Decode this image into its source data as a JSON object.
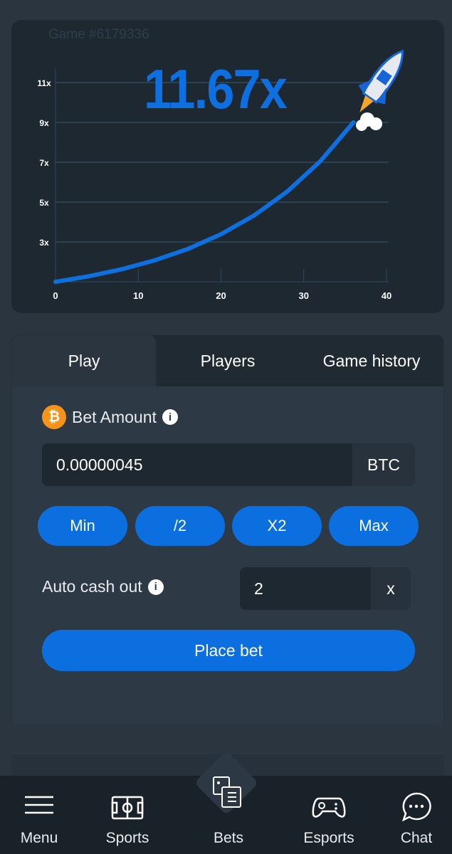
{
  "game": {
    "id_label": "Game #6179336",
    "multiplier": "11.67x"
  },
  "chart_data": {
    "type": "line",
    "x_ticks": [
      "0",
      "10",
      "20",
      "30",
      "40"
    ],
    "y_ticks": [
      "3x",
      "5x",
      "7x",
      "9x",
      "11x"
    ],
    "xlim": [
      0,
      40
    ],
    "ylim": [
      1,
      12
    ],
    "grid": "horizontal",
    "series": [
      {
        "x": [
          0,
          4,
          8,
          12,
          16,
          20,
          24,
          28,
          32,
          36
        ],
        "y": [
          1,
          1.28,
          1.63,
          2.08,
          2.65,
          3.39,
          4.33,
          5.53,
          7.05,
          9.0
        ],
        "color": "#0d6fe0"
      }
    ]
  },
  "tabs": [
    {
      "label": "Play",
      "active": true
    },
    {
      "label": "Players"
    },
    {
      "label": "Game history"
    }
  ],
  "play": {
    "bet_label": "Bet Amount",
    "bet_value": "0.00000045",
    "currency": "BTC",
    "quick": [
      "Min",
      "/2",
      "X2",
      "Max"
    ],
    "auto_label": "Auto cash out",
    "auto_value": "2",
    "auto_suffix": "x",
    "place": "Place bet"
  },
  "nav": [
    {
      "label": "Menu",
      "icon": "menu-icon"
    },
    {
      "label": "Sports",
      "icon": "sports-field-icon"
    },
    {
      "label": "Bets",
      "icon": "bets-icon"
    },
    {
      "label": "Esports",
      "icon": "gamepad-icon"
    },
    {
      "label": "Chat",
      "icon": "chat-icon"
    }
  ],
  "colors": {
    "accent": "#0b6fe0",
    "bitcoin": "#f7931a"
  }
}
